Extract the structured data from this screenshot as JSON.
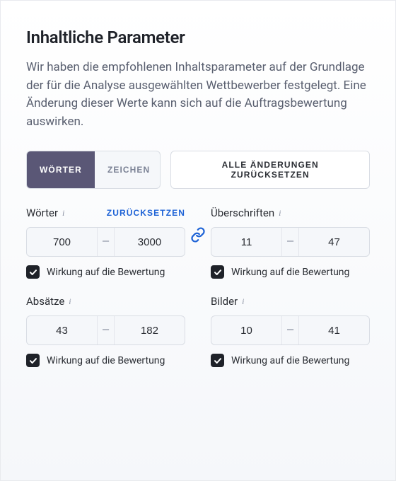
{
  "heading": "Inhaltliche Parameter",
  "description": "Wir haben die empfohlenen Inhaltsparameter auf der Grundlage der für die Analyse ausgewählten Wettbewerber festgelegt. Eine Änderung dieser Werte kann sich auf die Auftragsbewertung auswirken.",
  "toolbar": {
    "tab_words": "WÖRTER",
    "tab_chars": "ZEICHEN",
    "reset_all": "ALLE ÄNDERUNGEN ZURÜCKSETZEN"
  },
  "reset_label": "ZURÜCKSETZEN",
  "impact_label": "Wirkung auf die Bewertung",
  "params": {
    "words": {
      "label": "Wörter",
      "min": "700",
      "max": "3000",
      "show_reset": true
    },
    "headings": {
      "label": "Überschriften",
      "min": "11",
      "max": "47"
    },
    "paragraphs": {
      "label": "Absätze",
      "min": "43",
      "max": "182"
    },
    "images": {
      "label": "Bilder",
      "min": "10",
      "max": "41"
    }
  }
}
